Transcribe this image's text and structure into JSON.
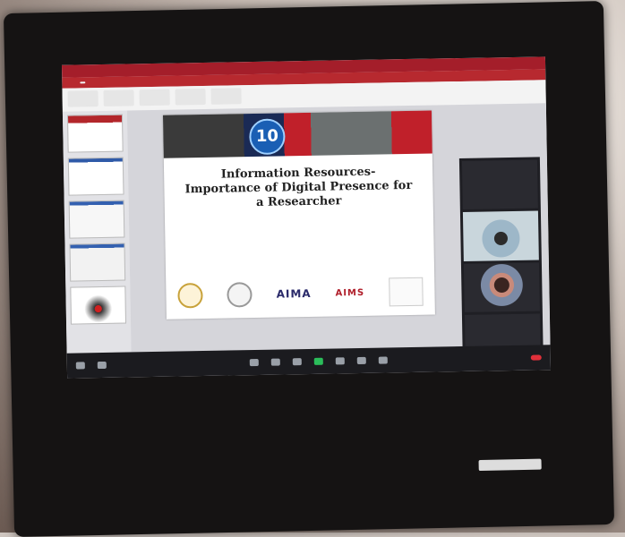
{
  "slide": {
    "title_line1": "Information Resources-",
    "title_line2": "Importance of Digital Presence for",
    "title_line3": "a Researcher",
    "banner_number": "10"
  },
  "logos": {
    "logo1": "AIMA",
    "logo2": "AIMS"
  }
}
